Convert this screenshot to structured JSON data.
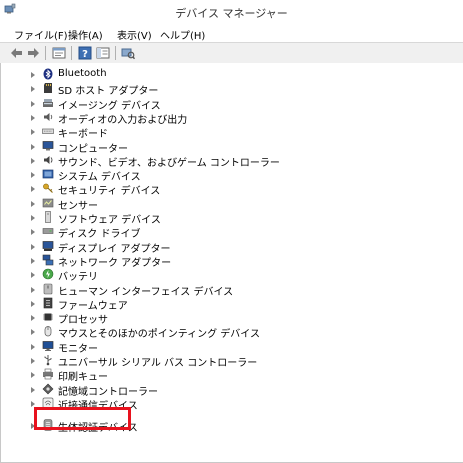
{
  "window": {
    "title": "デバイス マネージャー"
  },
  "menu": {
    "items": [
      "ファイル(F)",
      "操作(A)",
      "表示(V)",
      "ヘルプ(H)"
    ]
  },
  "toolbar": {
    "buttons": [
      "back-arrow-icon",
      "forward-arrow-icon",
      "properties-icon",
      "help-icon",
      "view-icon",
      "scan-hardware-icon"
    ]
  },
  "tree": {
    "items": [
      {
        "label": "Bluetooth",
        "icon": "bluetooth-icon"
      },
      {
        "label": "SD ホスト アダプター",
        "icon": "sd-host-adapter-icon"
      },
      {
        "label": "イメージング デバイス",
        "icon": "imaging-device-icon"
      },
      {
        "label": "オーディオの入力および出力",
        "icon": "audio-icon"
      },
      {
        "label": "キーボード",
        "icon": "keyboard-icon"
      },
      {
        "label": "コンピューター",
        "icon": "computer-icon"
      },
      {
        "label": "サウンド、ビデオ、およびゲーム コントローラー",
        "icon": "sound-icon"
      },
      {
        "label": "システム デバイス",
        "icon": "system-device-icon"
      },
      {
        "label": "セキュリティ デバイス",
        "icon": "security-device-icon"
      },
      {
        "label": "センサー",
        "icon": "sensor-icon"
      },
      {
        "label": "ソフトウェア デバイス",
        "icon": "software-device-icon"
      },
      {
        "label": "ディスク ドライブ",
        "icon": "disk-drive-icon"
      },
      {
        "label": "ディスプレイ アダプター",
        "icon": "display-adapter-icon"
      },
      {
        "label": "ネットワーク アダプター",
        "icon": "network-adapter-icon"
      },
      {
        "label": "バッテリ",
        "icon": "battery-icon"
      },
      {
        "label": "ヒューマン インターフェイス デバイス",
        "icon": "hid-icon"
      },
      {
        "label": "ファームウェア",
        "icon": "firmware-icon"
      },
      {
        "label": "プロセッサ",
        "icon": "processor-icon"
      },
      {
        "label": "マウスとそのほかのポインティング デバイス",
        "icon": "mouse-icon"
      },
      {
        "label": "モニター",
        "icon": "monitor-icon"
      },
      {
        "label": "ユニバーサル シリアル バス コントローラー",
        "icon": "usb-icon"
      },
      {
        "label": "印刷キュー",
        "icon": "print-queue-icon"
      },
      {
        "label": "記憶域コントローラー",
        "icon": "storage-controller-icon"
      },
      {
        "label": "近接通信デバイス",
        "icon": "proximity-device-icon"
      },
      {
        "label": "生体認証デバイス",
        "icon": "biometric-device-icon"
      }
    ]
  },
  "colors": {
    "highlight": "#e8121e",
    "toolbar_bg": "#f0f0f0",
    "expander": "#808080"
  }
}
